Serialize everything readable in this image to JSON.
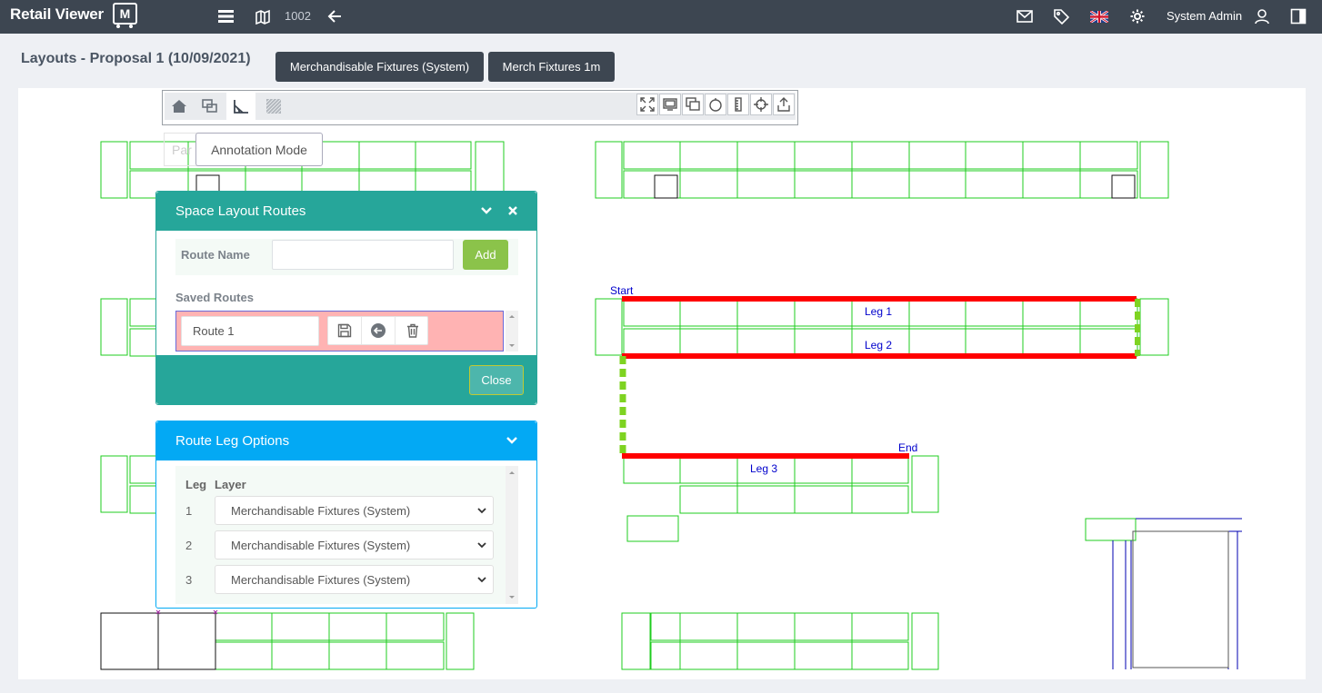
{
  "app": {
    "name": "Retail Viewer",
    "badge": "M",
    "store_number": "1002",
    "user_name": "System Admin"
  },
  "page": {
    "title": "Layouts - Proposal 1 (10/09/2021)",
    "tabs": [
      {
        "label": "Merchandisable Fixtures (System)"
      },
      {
        "label": "Merch Fixtures 1m"
      }
    ]
  },
  "toolbar": {
    "left_tools": [
      "home-icon",
      "annotation-layers-icon",
      "annotation-mode-icon",
      "hatch-pattern-icon"
    ],
    "right_tools": [
      "fit-extent-icon",
      "screen-icon",
      "overlap-icon",
      "circle-icon",
      "ruler-icon",
      "crosshair-icon",
      "export-icon"
    ],
    "tooltip": "Annotation Mode",
    "hidden_label": "Par"
  },
  "routes_panel": {
    "title": "Space Layout Routes",
    "route_name_label": "Route Name",
    "route_name_value": "",
    "add_label": "Add",
    "saved_routes_label": "Saved Routes",
    "saved_routes": [
      {
        "name": "Route 1"
      }
    ],
    "close_label": "Close"
  },
  "legs_panel": {
    "title": "Route Leg Options",
    "col_leg": "Leg",
    "col_layer": "Layer",
    "legs": [
      {
        "leg": "1",
        "layer": "Merchandisable Fixtures (System)"
      },
      {
        "leg": "2",
        "layer": "Merchandisable Fixtures (System)"
      },
      {
        "leg": "3",
        "layer": "Merchandisable Fixtures (System)"
      }
    ]
  },
  "plan_labels": {
    "start": "Start",
    "end": "End",
    "leg1": "Leg 1",
    "leg2": "Leg 2",
    "leg3": "Leg 3"
  },
  "colors": {
    "topbar": "#3d4651",
    "routes_panel": "#26a69a",
    "legs_panel": "#03a9f4",
    "add_button": "#8bc34a",
    "route_line": "#ff0000",
    "connector": "#7ed321",
    "fixture_outline": "#1fcc1f",
    "label_text": "#0000cc",
    "selected_route_bg": "#ffb3b3"
  }
}
